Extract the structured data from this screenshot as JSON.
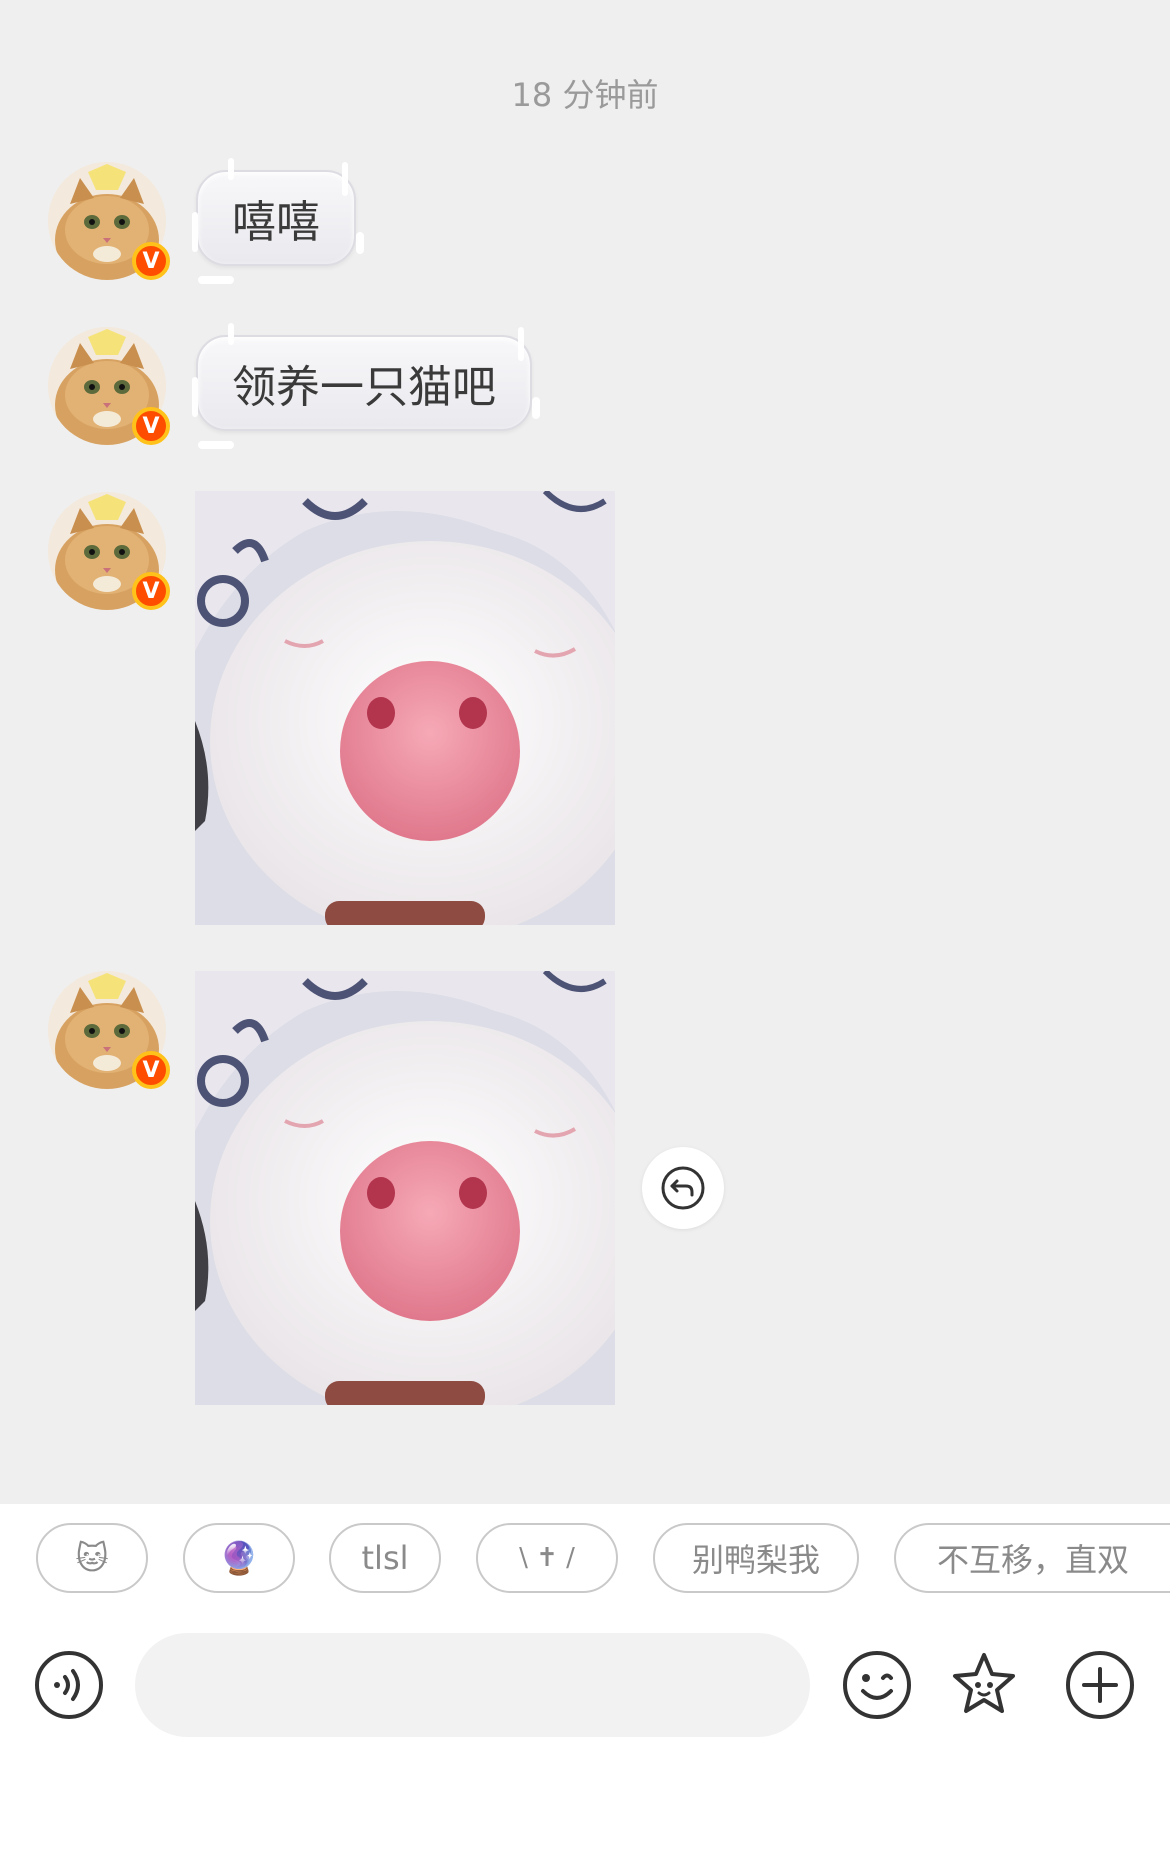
{
  "timestamp": "18 分钟前",
  "messages": [
    {
      "type": "text",
      "text": "嘻嘻"
    },
    {
      "type": "text",
      "text": "领养一只猫吧"
    },
    {
      "type": "image",
      "subject": "pig-snout-photo"
    },
    {
      "type": "image",
      "subject": "pig-snout-photo"
    }
  ],
  "avatar": {
    "badge": "V",
    "badge_color": "#ff4d00",
    "badge_ring": "#ffc21a"
  },
  "quick_replies": [
    "🐱",
    "🔮",
    "tlsl",
    "\\ ✝ /",
    "别鸭梨我",
    "不互移，直双"
  ],
  "input": {
    "placeholder": ""
  },
  "icons": {
    "left": "voice-icon",
    "right": [
      "emoji-icon",
      "sticker-star-icon",
      "plus-icon"
    ],
    "reply": "reply-icon"
  },
  "colors": {
    "chat_bg": "#efefef",
    "chip_border": "#c9c9c9"
  }
}
